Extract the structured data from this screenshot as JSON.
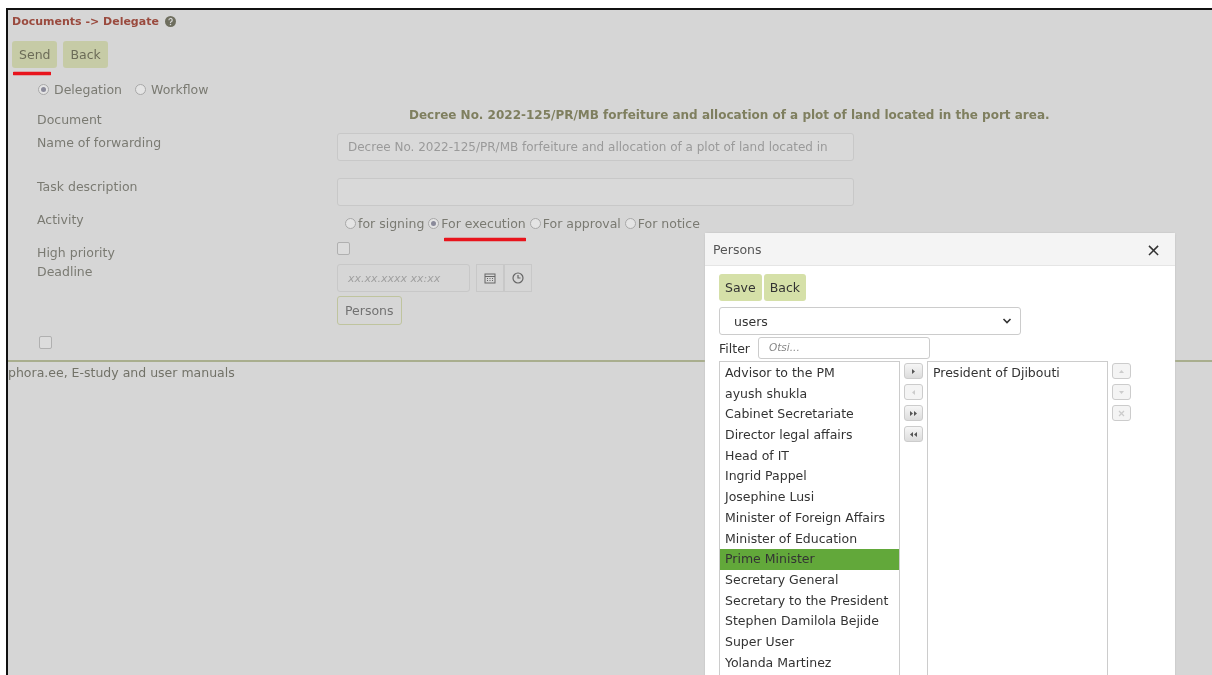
{
  "breadcrumb": "Documents -> Delegate",
  "toolbar": [
    "Send",
    "Back"
  ],
  "mode": [
    {
      "label": "Delegation",
      "selected": true
    },
    {
      "label": "Workflow",
      "selected": false
    }
  ],
  "form": {
    "document_label": "Document",
    "document_title": "Decree No. 2022-125/PR/MB forfeiture and allocation of a plot of land located in the port area.",
    "forwarding_label": "Name of forwarding",
    "forwarding_value": "Decree No. 2022-125/PR/MB forfeiture and allocation of a plot of land located in",
    "task_label": "Task description",
    "activity_label": "Activity",
    "activities": [
      {
        "label": "for signing",
        "selected": false
      },
      {
        "label": "For execution",
        "selected": true
      },
      {
        "label": "For approval",
        "selected": false
      },
      {
        "label": "For notice",
        "selected": false
      }
    ],
    "priority_label": "High priority",
    "high_priority": false,
    "deadline_label": "Deadline",
    "deadline_placeholder": "xx.xx.xxxx xx:xx",
    "persons_button": "Persons",
    "extra_checked": false
  },
  "footer": "phora.ee, E-study and user manuals",
  "dialog": {
    "title": "Persons",
    "close": "×",
    "buttons": [
      "Save",
      "Back"
    ],
    "group": "users",
    "filter_label": "Filter",
    "filter_placeholder": "Otsi...",
    "available": [
      {
        "name": "Advisor to the PM",
        "selected": false
      },
      {
        "name": "ayush shukla",
        "selected": false
      },
      {
        "name": "Cabinet Secretariate",
        "selected": false
      },
      {
        "name": "Director legal affairs",
        "selected": false
      },
      {
        "name": "Head of IT",
        "selected": false
      },
      {
        "name": "Ingrid Pappel",
        "selected": false
      },
      {
        "name": "Josephine Lusi",
        "selected": false
      },
      {
        "name": "Minister of Foreign Affairs",
        "selected": false
      },
      {
        "name": "Minister of Education",
        "selected": false
      },
      {
        "name": "Prime Minister",
        "selected": true
      },
      {
        "name": "Secretary General",
        "selected": false
      },
      {
        "name": "Secretary to the President",
        "selected": false
      },
      {
        "name": "Stephen Damilola Bejide",
        "selected": false
      },
      {
        "name": "Super User",
        "selected": false
      },
      {
        "name": "Yolanda Martinez",
        "selected": false
      }
    ],
    "transfer": [
      {
        "kind": "add",
        "disabled": false
      },
      {
        "kind": "remove",
        "disabled": true
      },
      {
        "kind": "add_all",
        "disabled": false
      },
      {
        "kind": "remove_all",
        "disabled": false
      }
    ],
    "chosen": [
      {
        "name": "President of Djibouti",
        "selected": false
      }
    ],
    "order": [
      {
        "kind": "up",
        "disabled": true
      },
      {
        "kind": "down",
        "disabled": true
      },
      {
        "kind": "delete",
        "disabled": true
      }
    ]
  }
}
